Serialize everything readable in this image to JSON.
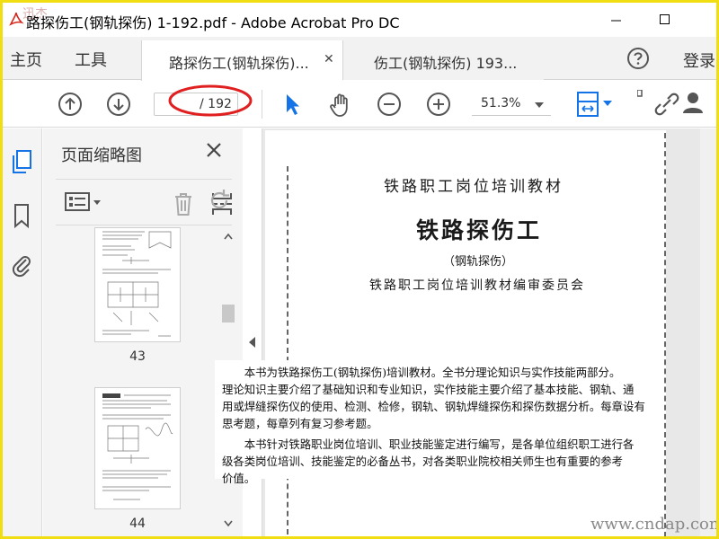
{
  "window": {
    "title": "路探伤工(钢轨探伤) 1-192.pdf - Adobe Acrobat Pro DC",
    "corner_watermark": "迅杰",
    "accent": "#1473e6",
    "border_color": "#f0dd12"
  },
  "menu": {
    "home": "主页",
    "tools": "工具",
    "login": "登录"
  },
  "tabs": [
    {
      "label": "路探伤工(钢轨探伤)...",
      "active": true
    },
    {
      "label": "伤工(钢轨探伤) 193...",
      "active": false
    }
  ],
  "toolbar": {
    "page_current": "",
    "page_total": "/ 192",
    "zoom": "51.3%",
    "icons": [
      "arrow-up-circle-icon",
      "arrow-down-circle-icon",
      "select-pointer-icon",
      "hand-icon",
      "zoom-out-icon",
      "zoom-in-icon",
      "page-fit-icon",
      "link-icon",
      "user-icon"
    ]
  },
  "thumbnails_panel": {
    "title": "页面缩略图",
    "pages": [
      {
        "number": "43"
      },
      {
        "number": "44"
      }
    ]
  },
  "document": {
    "series": "铁路职工岗位培训教材",
    "title": "铁路探伤工",
    "subtitle": "（钢轨探伤）",
    "committee": "铁路职工岗位培训教材编审委员会",
    "paragraph": [
      "　　本书为铁路探伤工(钢轨探伤)培训教材。全书分理论知识与实作技能两部分。",
      "理论知识主要介绍了基础知识和专业知识，实作技能主要介绍了基本技能、钢轨、通",
      "用或焊缝探伤仪的使用、检测、检修，钢轨、钢轨焊缝探伤和探伤数据分析。每章设有",
      "思考题，每章列有复习参考题。",
      "　　本书针对铁路职业岗位培训、职业技能鉴定进行编写，是各单位组织职工进行各",
      "级各类岗位培训、技能鉴定的必备丛书，对各类职业院校相关师生也有重要的参考",
      "价值。"
    ]
  },
  "watermark": "www.cndap.com"
}
